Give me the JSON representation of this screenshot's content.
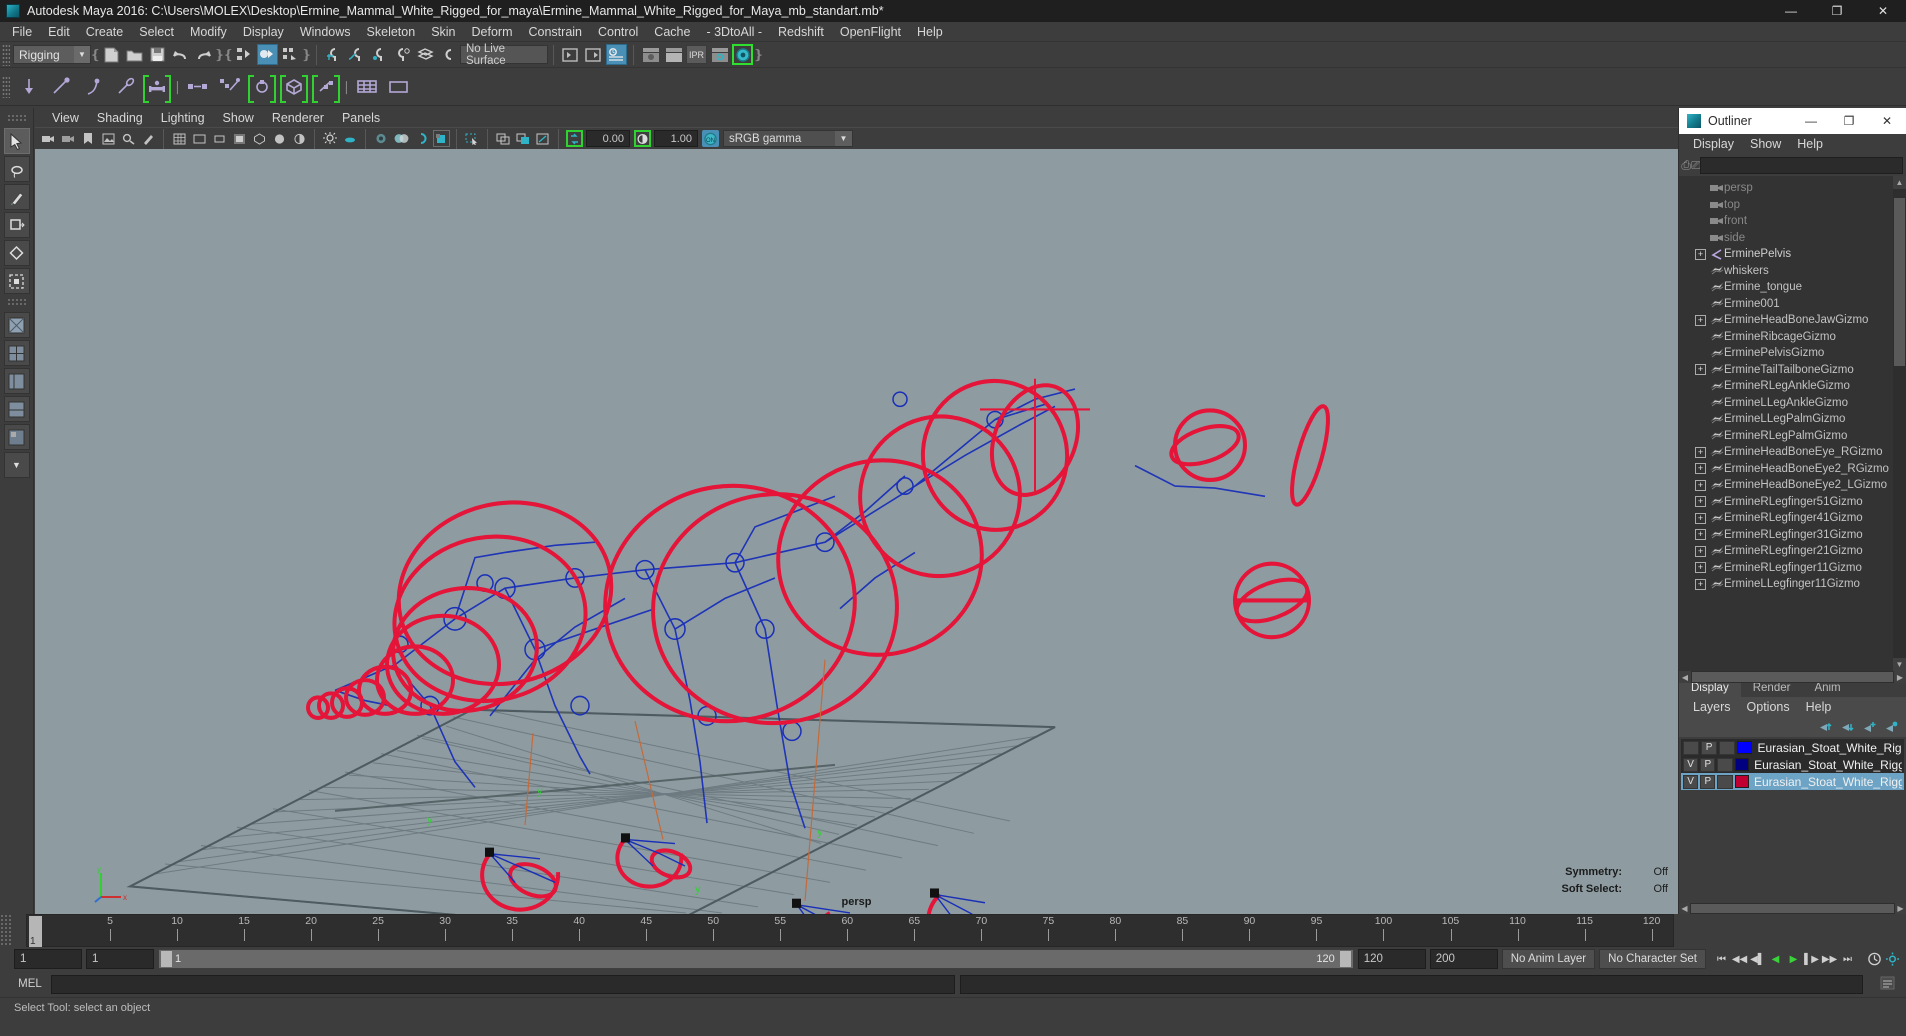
{
  "window": {
    "title": "Autodesk Maya 2016: C:\\Users\\MOLEX\\Desktop\\Ermine_Mammal_White_Rigged_for_maya\\Ermine_Mammal_White_Rigged_for_Maya_mb_standart.mb*",
    "minimize": "—",
    "maximize": "❐",
    "close": "✕",
    "icon": "maya-app-icon"
  },
  "menubar": [
    "File",
    "Edit",
    "Create",
    "Select",
    "Modify",
    "Display",
    "Windows",
    "Skeleton",
    "Skin",
    "Deform",
    "Constrain",
    "Control",
    "Cache",
    "- 3DtoAll -",
    "Redshift",
    "OpenFlight",
    "Help"
  ],
  "statusline": {
    "menuset": "Rigging",
    "live_surface": "No Live Surface",
    "ipr_label": "IPR"
  },
  "viewport_panel": {
    "menus": [
      "View",
      "Shading",
      "Lighting",
      "Show",
      "Renderer",
      "Panels"
    ],
    "exposure": "0.00",
    "gamma": "1.00",
    "color_mgmt": "sRGB gamma",
    "camera_label": "persp",
    "hud": [
      {
        "label": "Symmetry:",
        "value": "Off"
      },
      {
        "label": "Soft Select:",
        "value": "Off"
      }
    ]
  },
  "outliner": {
    "title": "Outliner",
    "minimize": "—",
    "maximize": "❐",
    "close": "✕",
    "menus": [
      "Display",
      "Show",
      "Help"
    ],
    "search_value": "",
    "items": [
      {
        "label": "persp",
        "kind": "cam",
        "expandable": false
      },
      {
        "label": "top",
        "kind": "cam",
        "expandable": false
      },
      {
        "label": "front",
        "kind": "cam",
        "expandable": false
      },
      {
        "label": "side",
        "kind": "cam",
        "expandable": false
      },
      {
        "label": "ErminePelvis",
        "kind": "bone",
        "expandable": true
      },
      {
        "label": "whiskers",
        "kind": "mesh",
        "expandable": false
      },
      {
        "label": "Ermine_tongue",
        "kind": "mesh",
        "expandable": false
      },
      {
        "label": "Ermine001",
        "kind": "mesh",
        "expandable": false
      },
      {
        "label": "ErmineHeadBoneJawGizmo",
        "kind": "mesh",
        "expandable": true
      },
      {
        "label": "ErmineRibcageGizmo",
        "kind": "mesh",
        "expandable": false
      },
      {
        "label": "ErminePelvisGizmo",
        "kind": "mesh",
        "expandable": false
      },
      {
        "label": "ErmineTailTailboneGizmo",
        "kind": "mesh",
        "expandable": true
      },
      {
        "label": "ErmineRLegAnkleGizmo",
        "kind": "mesh",
        "expandable": false
      },
      {
        "label": "ErmineLLegAnkleGizmo",
        "kind": "mesh",
        "expandable": false
      },
      {
        "label": "ErmineLLegPalmGizmo",
        "kind": "mesh",
        "expandable": false
      },
      {
        "label": "ErmineRLegPalmGizmo",
        "kind": "mesh",
        "expandable": false
      },
      {
        "label": "ErmineHeadBoneEye_RGizmo",
        "kind": "mesh",
        "expandable": true
      },
      {
        "label": "ErmineHeadBoneEye2_RGizmo",
        "kind": "mesh",
        "expandable": true
      },
      {
        "label": "ErmineHeadBoneEye2_LGizmo",
        "kind": "mesh",
        "expandable": true
      },
      {
        "label": "ErmineRLegfinger51Gizmo",
        "kind": "mesh",
        "expandable": true
      },
      {
        "label": "ErmineRLegfinger41Gizmo",
        "kind": "mesh",
        "expandable": true
      },
      {
        "label": "ErmineRLegfinger31Gizmo",
        "kind": "mesh",
        "expandable": true
      },
      {
        "label": "ErmineRLegfinger21Gizmo",
        "kind": "mesh",
        "expandable": true
      },
      {
        "label": "ErmineRLegfinger11Gizmo",
        "kind": "mesh",
        "expandable": true
      },
      {
        "label": "ErmineLLegfinger11Gizmo",
        "kind": "mesh",
        "expandable": true
      }
    ]
  },
  "layereditor": {
    "tabs": [
      "Display",
      "Render",
      "Anim"
    ],
    "active_tab": "Display",
    "menus": [
      "Layers",
      "Options",
      "Help"
    ],
    "rows": [
      {
        "visible": "",
        "playback": "P",
        "third": "",
        "color": "#0000ff",
        "name": "Eurasian_Stoat_White_Rigged",
        "selected": false
      },
      {
        "visible": "V",
        "playback": "P",
        "third": "",
        "color": "#000080",
        "name": "Eurasian_Stoat_White_Rigged_B",
        "selected": false
      },
      {
        "visible": "V",
        "playback": "P",
        "third": "",
        "color": "#c00030",
        "name": "Eurasian_Stoat_White_Rigged_C",
        "selected": true
      }
    ]
  },
  "timeline": {
    "ticks": [
      5,
      10,
      15,
      20,
      25,
      30,
      35,
      40,
      45,
      50,
      55,
      60,
      65,
      70,
      75,
      80,
      85,
      90,
      95,
      100,
      105,
      110,
      115,
      120
    ],
    "current_frame": "1",
    "range_start": "1",
    "range_start2": "1",
    "range_bar_left": "1",
    "range_bar_right": "120",
    "range_end": "120",
    "playback_end": "200",
    "anim_layer": "No Anim Layer",
    "character_set": "No Character Set",
    "frame_field": "1"
  },
  "command": {
    "type_label": "MEL",
    "input_value": "",
    "result_value": ""
  },
  "statusbar": {
    "message": "Select Tool: select an object"
  },
  "colors": {
    "accent": "#4a8fb5",
    "viewport_bg": "#8e9ca2",
    "control_red": "#e01030",
    "skeleton_blue": "#1a2fa0",
    "green_highlight": "#32d132"
  }
}
